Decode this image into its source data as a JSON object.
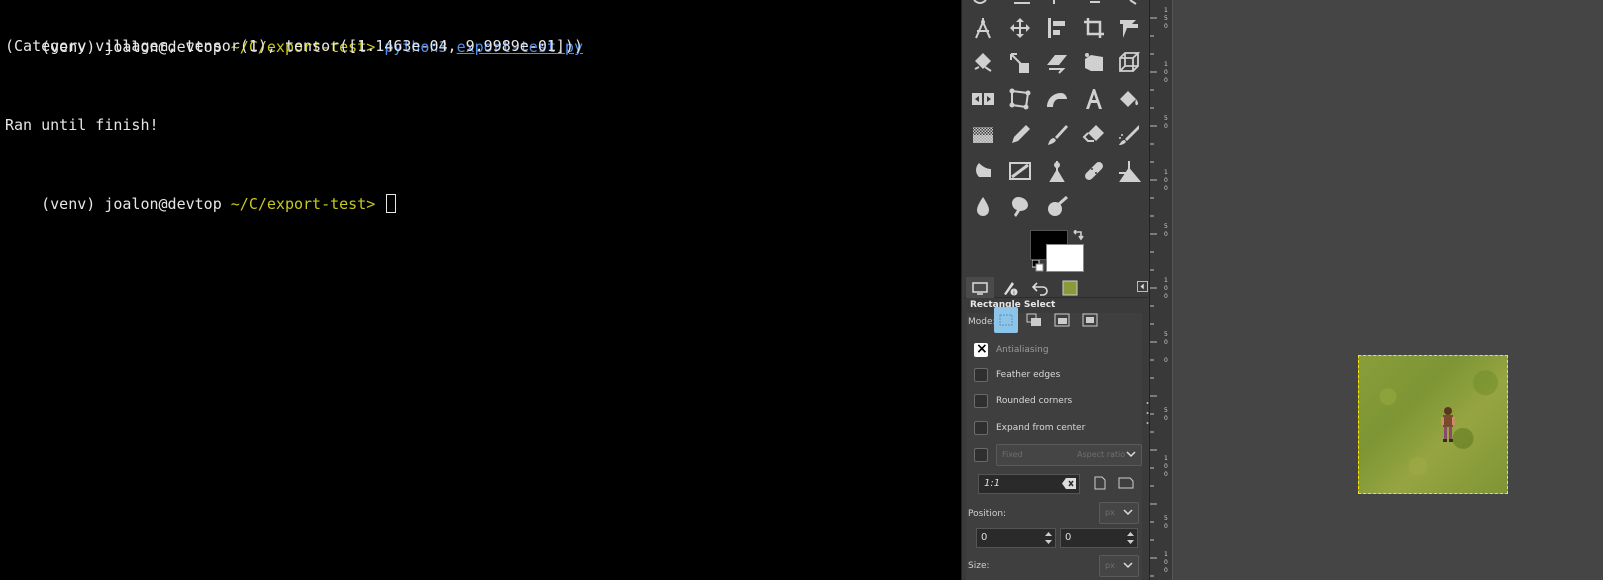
{
  "terminal": {
    "line1": {
      "venv": "(venv)",
      "user_host": "joalon@devtop",
      "path": "~/C/export-test>",
      "command": "python3",
      "argument": "export-test.py"
    },
    "output1": "(Category villager, tensor(1), tensor([1.1463e-04, 9.9989e-01]))",
    "output2": "Ran until finish!",
    "line2": {
      "venv": "(venv)",
      "user_host": "joalon@devtop",
      "path": "~/C/export-test>"
    }
  },
  "gimp": {
    "tool_options_title": "Rectangle Select",
    "mode_label": "Mode:",
    "options": {
      "antialiasing": "Antialiasing",
      "feather": "Feather edges",
      "rounded": "Rounded corners",
      "expand": "Expand from center"
    },
    "fixed_combo": {
      "left": "Fixed",
      "right": "Aspect ratio"
    },
    "ratio_value": "1:1",
    "position_label": "Position:",
    "position_unit": "px",
    "position_x": "0",
    "position_y": "0",
    "size_label": "Size:",
    "size_unit": "px"
  },
  "colors": {
    "terminal_bg": "#000000",
    "prompt_path": "#c8c820",
    "command": "#4f8ff0",
    "panel_bg": "#3b3b3b",
    "canvas_bg": "#454545",
    "mode_active": "#8dc4ea",
    "selection_marching_ants": "#ffe400"
  },
  "icons": [
    "ellipse-select-icon",
    "move-icon",
    "align-icon",
    "crop-icon",
    "unified-transform-icon",
    "rotate-icon",
    "scale-icon",
    "shear-icon",
    "perspective-icon",
    "3d-transform-icon",
    "flip-icon",
    "cage-transform-icon",
    "warp-transform-icon",
    "text-icon",
    "bucket-fill-icon",
    "gradient-icon",
    "pencil-icon",
    "paintbrush-icon",
    "eraser-icon",
    "airbrush-icon",
    "ink-icon",
    "mypaint-brush-icon",
    "clone-icon",
    "heal-icon",
    "perspective-clone-icon",
    "blur-icon",
    "smudge-icon",
    "dodge-burn-icon"
  ]
}
